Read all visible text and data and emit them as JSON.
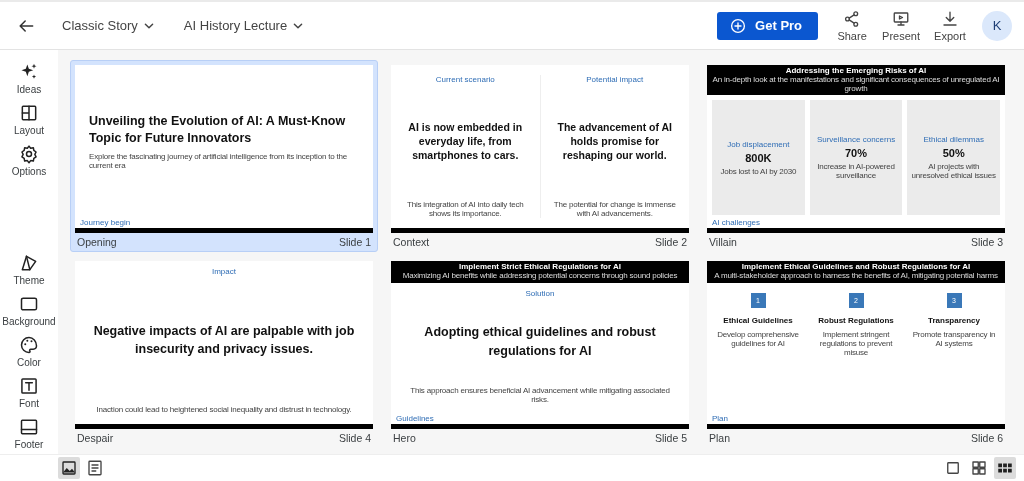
{
  "top_bar": {
    "menus": [
      {
        "label": "Classic Story"
      },
      {
        "label": "AI History Lecture"
      }
    ],
    "upgrade_button": "Get Pro",
    "actions": [
      {
        "label": "Share"
      },
      {
        "label": "Present"
      },
      {
        "label": "Export"
      }
    ],
    "avatar": "K"
  },
  "sidebar": {
    "groups": [
      [
        {
          "label": "Ideas"
        },
        {
          "label": "Layout"
        },
        {
          "label": "Options"
        }
      ],
      [
        {
          "label": "Theme"
        },
        {
          "label": "Background"
        },
        {
          "label": "Color"
        },
        {
          "label": "Font"
        },
        {
          "label": "Footer"
        }
      ]
    ]
  },
  "slides": [
    {
      "kind": "title",
      "name": "Opening",
      "number": "Slide 1",
      "selected": true,
      "heading": "Unveiling the Evolution of AI: A Must-Know Topic for Future Innovators",
      "subtitle": "Explore the fascinating journey of artificial intelligence from its inception to the current era",
      "footer_label": "Journey begin"
    },
    {
      "kind": "columns",
      "name": "Context",
      "number": "Slide 2",
      "selected": false,
      "columns": [
        {
          "label": "Current scenario",
          "text": "AI is now embedded in everyday life, from smartphones to cars.",
          "note": "This integration of AI into daily tech shows its importance."
        },
        {
          "label": "Potential impact",
          "text": "The advancement of AI holds promise for reshaping our world.",
          "note": "The potential for change is immense with AI advancements."
        }
      ]
    },
    {
      "kind": "stats",
      "name": "Villain",
      "number": "Slide 3",
      "selected": false,
      "header": {
        "title": "Addressing the Emerging Risks of AI",
        "subtitle": "An in-depth look at the manifestations and significant consequences of unregulated AI growth"
      },
      "cards": [
        {
          "label": "Job displacement",
          "value": "800K",
          "note": "Jobs lost to AI by 2030"
        },
        {
          "label": "Surveillance concerns",
          "value": "70%",
          "note": "Increase in AI-powered surveillance"
        },
        {
          "label": "Ethical dilemmas",
          "value": "50%",
          "note": "AI projects with unresolved ethical issues"
        }
      ],
      "footer_label": "AI challenges"
    },
    {
      "kind": "statement",
      "name": "Despair",
      "number": "Slide 4",
      "selected": false,
      "label": "Impact",
      "text": "Negative impacts of AI are palpable with job insecurity and privacy issues.",
      "note": "Inaction could lead to heightened social inequality and distrust in technology."
    },
    {
      "kind": "statement",
      "name": "Hero",
      "number": "Slide 5",
      "selected": false,
      "header": {
        "title": "Implement Strict Ethical Regulations for AI",
        "subtitle": "Maximizing AI benefits while addressing potential concerns through sound policies"
      },
      "label": "Solution",
      "text": "Adopting ethical guidelines and robust regulations for AI",
      "note": "This approach ensures beneficial AI advancement while mitigating associated risks.",
      "footer_label": "Guidelines"
    },
    {
      "kind": "steps",
      "name": "Plan",
      "number": "Slide 6",
      "selected": false,
      "header": {
        "title": "Implement Ethical Guidelines and Robust Regulations for AI",
        "subtitle": "A multi-stakeholder approach to harness the benefits of AI, mitigating potential harms"
      },
      "steps": [
        {
          "number": "1",
          "title": "Ethical Guidelines",
          "note": "Develop comprehensive guidelines for AI"
        },
        {
          "number": "2",
          "title": "Robust Regulations",
          "note": "Implement stringent regulations to prevent misuse"
        },
        {
          "number": "3",
          "title": "Transparency",
          "note": "Promote transparency in AI systems"
        }
      ],
      "footer_label": "Plan"
    }
  ],
  "bottom_bar": {
    "left": [
      {
        "selected": true
      },
      {
        "selected": false
      }
    ],
    "right": [
      {
        "selected": false
      },
      {
        "selected": false
      },
      {
        "selected": true
      }
    ]
  }
}
